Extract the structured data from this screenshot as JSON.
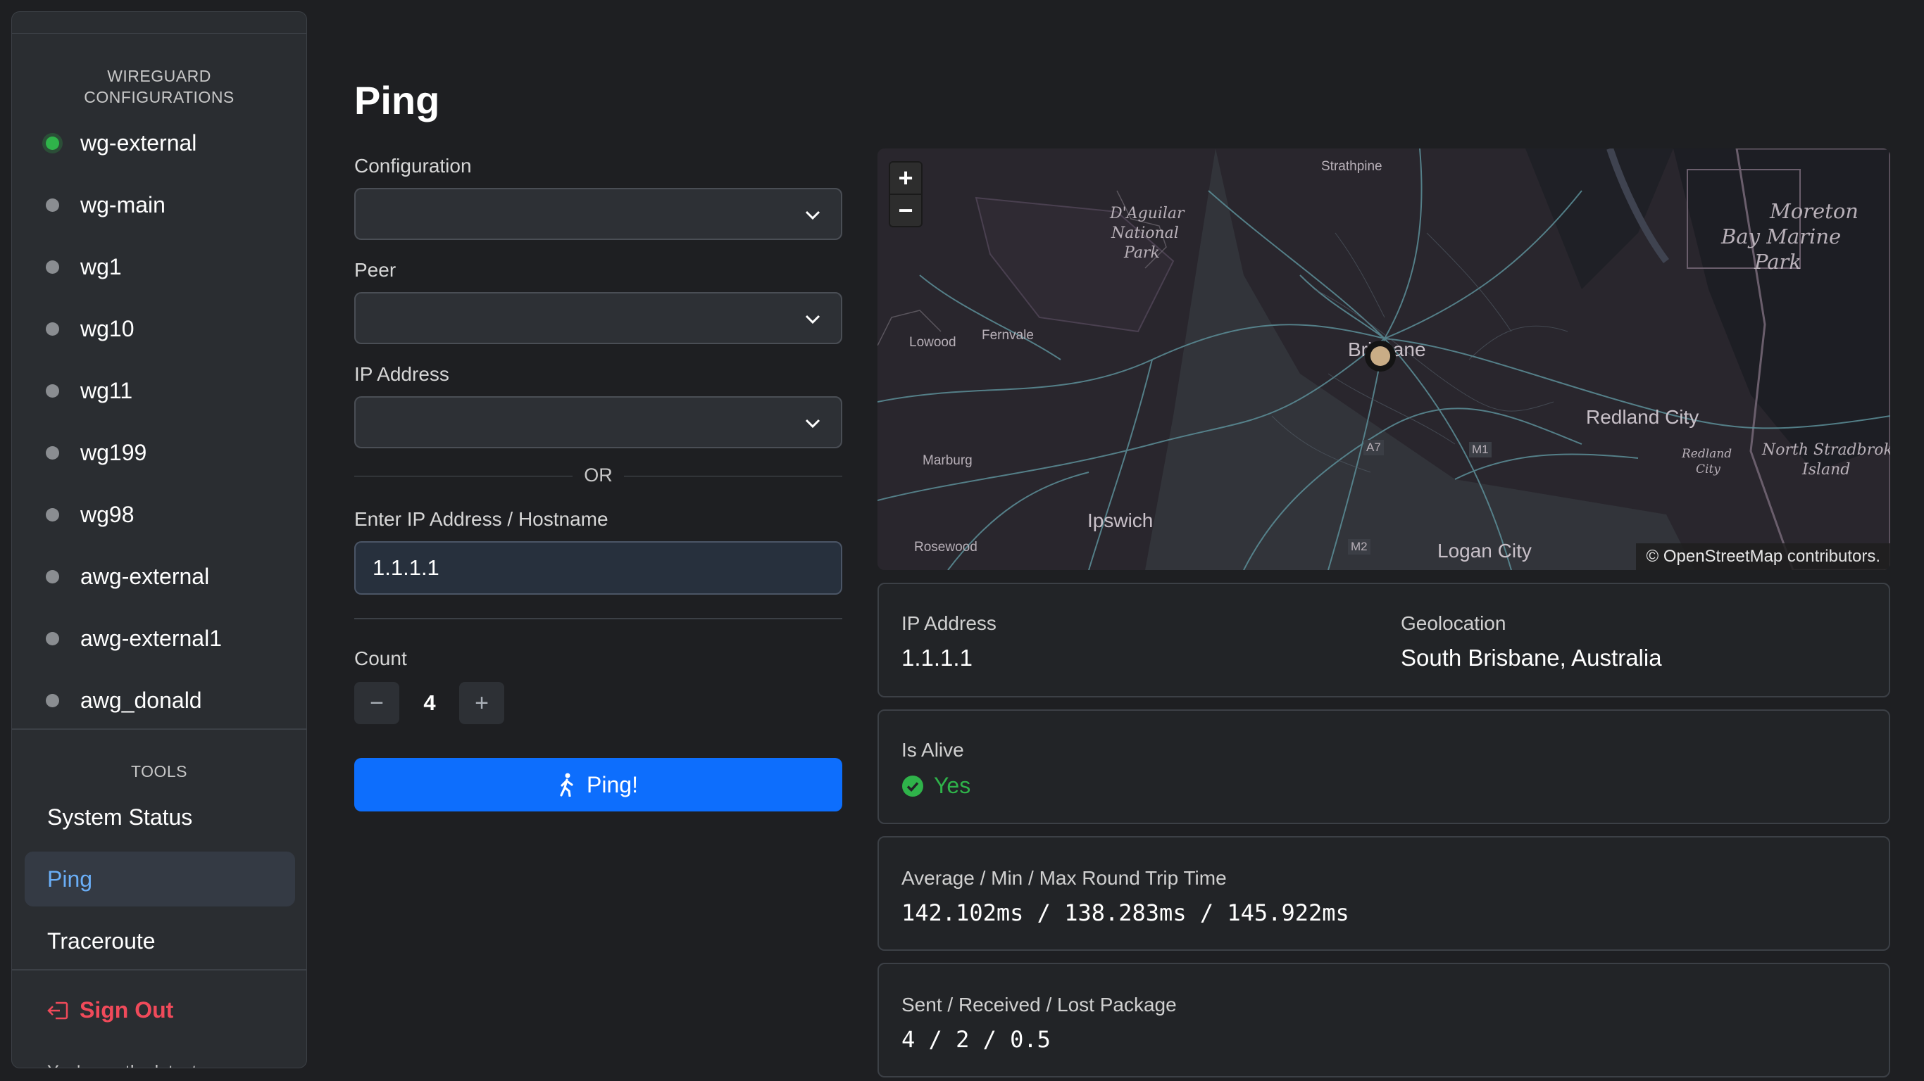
{
  "sidebar": {
    "configs_heading_line1": "WIREGUARD",
    "configs_heading_line2": "CONFIGURATIONS",
    "configs": [
      {
        "name": "wg-external",
        "status": "active"
      },
      {
        "name": "wg-main",
        "status": "inactive"
      },
      {
        "name": "wg1",
        "status": "inactive"
      },
      {
        "name": "wg10",
        "status": "inactive"
      },
      {
        "name": "wg11",
        "status": "inactive"
      },
      {
        "name": "wg199",
        "status": "inactive"
      },
      {
        "name": "wg98",
        "status": "inactive"
      },
      {
        "name": "awg-external",
        "status": "inactive"
      },
      {
        "name": "awg-external1",
        "status": "inactive"
      },
      {
        "name": "awg_donald",
        "status": "inactive"
      }
    ],
    "tools_heading": "TOOLS",
    "tools": [
      {
        "label": "System Status",
        "active": false
      },
      {
        "label": "Ping",
        "active": true
      },
      {
        "label": "Traceroute",
        "active": false
      }
    ],
    "sign_out": "Sign Out",
    "latest_note": "You're on the latest"
  },
  "form": {
    "title": "Ping",
    "configuration_label": "Configuration",
    "configuration_value": "",
    "peer_label": "Peer",
    "peer_value": "",
    "ip_label": "IP Address",
    "ip_value": "",
    "or_text": "OR",
    "host_label": "Enter IP Address / Hostname",
    "host_value": "1.1.1.1",
    "count_label": "Count",
    "count_value": "4",
    "decrement": "−",
    "increment": "+",
    "ping_button": "Ping!"
  },
  "map": {
    "attribution_symbol": "©",
    "attribution_link": "OpenStreetMap",
    "attribution_suffix": " contributors.",
    "zoom_in": "+",
    "zoom_out": "−",
    "labels": {
      "strathpine": "Strathpine",
      "daguilar1": "D'Aguilar",
      "daguilar2": "National",
      "daguilar3": "Park",
      "lowood": "Lowood",
      "fernvale": "Fernvale",
      "brisbane": "Brisbane",
      "marburg": "Marburg",
      "ipswich": "Ipswich",
      "rosewood": "Rosewood",
      "logan": "Logan City",
      "redland": "Redland City",
      "redland_small1": "Redland",
      "redland_small2": "City",
      "moreton1": "Moreton",
      "moreton2": "Bay Marine",
      "moreton3": "Park",
      "north_stradbroke1": "North Stradbroke",
      "north_stradbroke2": "Island",
      "a7": "A7",
      "m1": "M1",
      "m2": "M2"
    }
  },
  "results": {
    "ip_label": "IP Address",
    "ip_value": "1.1.1.1",
    "geo_label": "Geolocation",
    "geo_value": "South Brisbane, Australia",
    "alive_label": "Is Alive",
    "alive_value": "Yes",
    "rtt_label": "Average / Min / Max Round Trip Time",
    "rtt_value": "142.102ms / 138.283ms / 145.922ms",
    "packets_label": "Sent / Received / Lost Package",
    "packets_value": "4 / 2 / 0.5"
  },
  "colors": {
    "accent": "#0d6efd",
    "active_status": "#2fb34a",
    "danger": "#f04a5a",
    "link": "#6aaef7"
  }
}
